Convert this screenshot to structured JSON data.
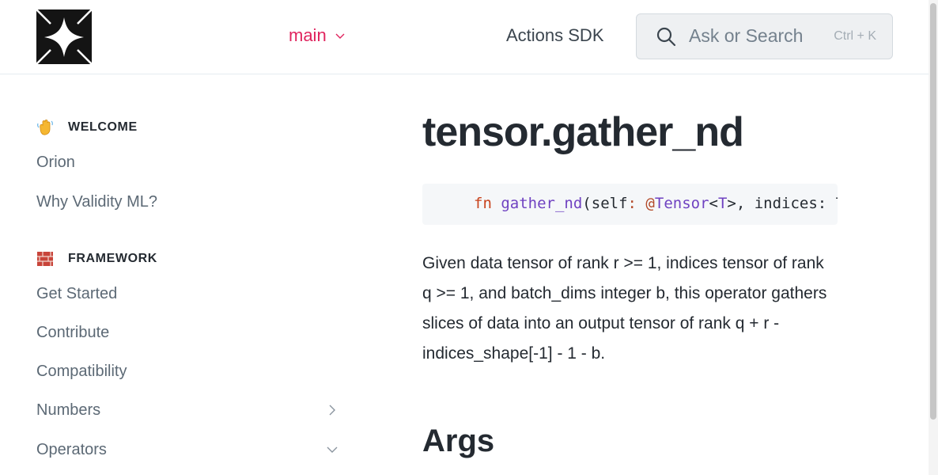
{
  "header": {
    "logo_name": "logo-icon",
    "version_label": "main",
    "sdk_link": "Actions SDK",
    "search": {
      "placeholder": "Ask or Search",
      "shortcut": "Ctrl + K"
    }
  },
  "sidebar": {
    "sections": [
      {
        "icon": "waving-hand-icon",
        "title": "WELCOME",
        "items": [
          {
            "label": "Orion"
          },
          {
            "label": "Why Validity ML?"
          }
        ]
      },
      {
        "icon": "bricks-icon",
        "title": "FRAMEWORK",
        "items": [
          {
            "label": "Get Started"
          },
          {
            "label": "Contribute"
          },
          {
            "label": "Compatibility"
          },
          {
            "label": "Numbers",
            "chevron": "chevron-right-icon"
          },
          {
            "label": "Operators",
            "chevron": "chevron-down-icon"
          }
        ]
      }
    ]
  },
  "main": {
    "title": "tensor.gather_nd",
    "code": {
      "kw": "fn",
      "fn_name": "gather_nd",
      "open": "(",
      "self": "self",
      "colon": ":",
      "space": " ",
      "at": "@",
      "type": "Tensor",
      "lt": "<",
      "generic": "T",
      "gt_rest": ">, indices: Tensor<usize>, batch_dims: Option<usize>) -> Tensor<T>;"
    },
    "description": "Given data tensor of rank r >= 1, indices tensor of rank q >= 1, and batch_dims integer b, this operator gathers slices of data into an output tensor of rank q + r - indices_shape[-1] - 1 - b.",
    "args_heading": "Args"
  },
  "colors": {
    "accent": "#e0245e",
    "text": "#242a31",
    "muted": "#5c6975"
  }
}
